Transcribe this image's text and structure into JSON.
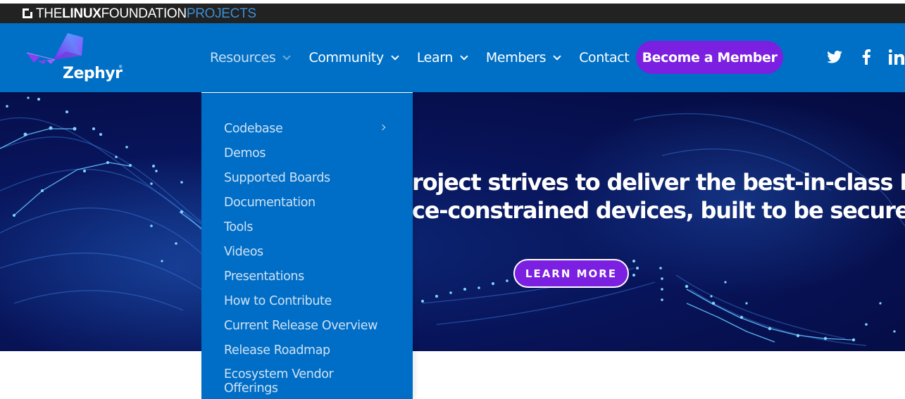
{
  "lf_bar": {
    "the": "THE",
    "linux": "LINUX",
    "foundation": "FOUNDATION",
    "projects": "PROJECTS"
  },
  "brand": {
    "name": "Zephyr",
    "reg": "®"
  },
  "nav": {
    "items": [
      {
        "label": "Resources",
        "has_menu": true,
        "active": true
      },
      {
        "label": "Community",
        "has_menu": true
      },
      {
        "label": "Learn",
        "has_menu": true
      },
      {
        "label": "Members",
        "has_menu": true
      },
      {
        "label": "Contact",
        "has_menu": false
      }
    ],
    "cta": "Become a Member",
    "social": [
      "twitter-icon",
      "facebook-icon",
      "linkedin-icon"
    ]
  },
  "hero": {
    "line1": "roject strives to deliver the best-in-class RTOS for",
    "line2": "ce-constrained devices, built to be secure and safe.",
    "button": "LEARN MORE"
  },
  "dropdown": {
    "items": [
      {
        "label": "Codebase",
        "submenu": true
      },
      {
        "label": "Demos"
      },
      {
        "label": "Supported Boards"
      },
      {
        "label": "Documentation"
      },
      {
        "label": "Tools"
      },
      {
        "label": "Videos"
      },
      {
        "label": "Presentations"
      },
      {
        "label": "How to Contribute"
      },
      {
        "label": "Current Release Overview"
      },
      {
        "label": "Release Roadmap"
      },
      {
        "label": "Ecosystem Vendor Offerings"
      }
    ]
  },
  "colors": {
    "nav_blue": "#0070c6",
    "purple": "#7b1fe0",
    "lf_dark": "#222222",
    "hero_navy": "#08145a"
  }
}
